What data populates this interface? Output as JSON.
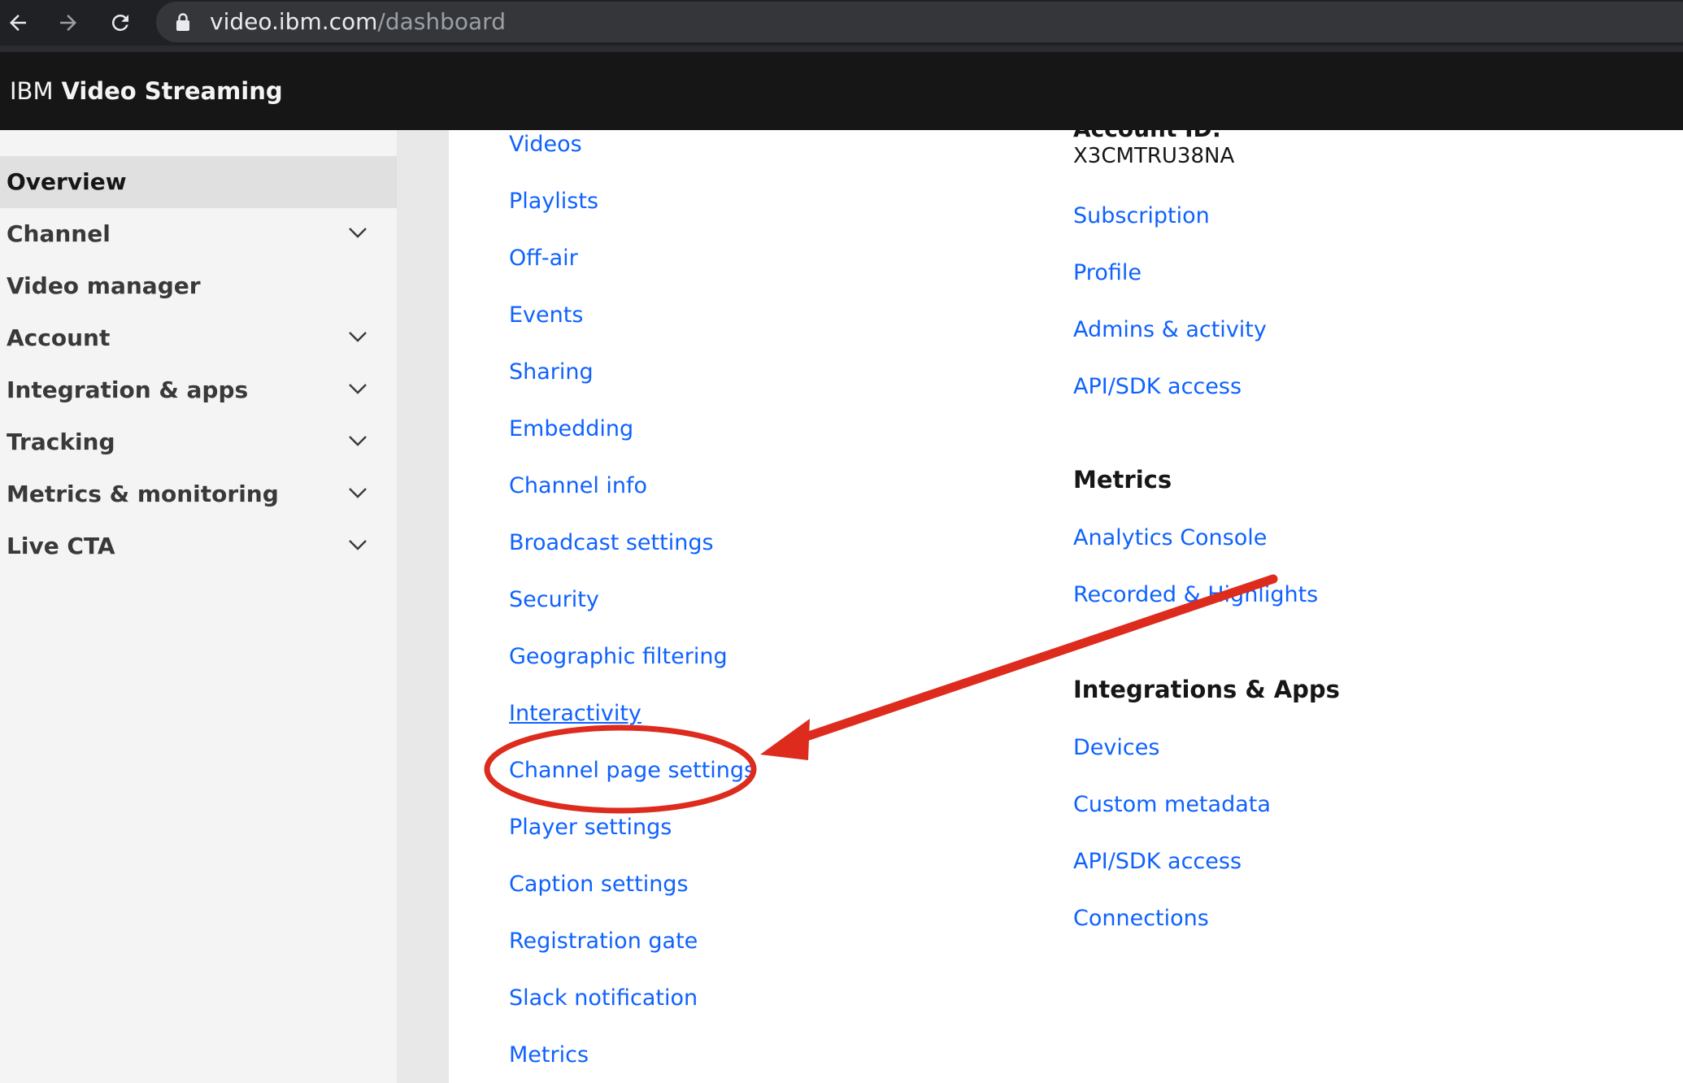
{
  "browser": {
    "url_host": "video.ibm.com",
    "url_path": "/dashboard",
    "icons": [
      "back-arrow-icon",
      "forward-arrow-icon",
      "reload-icon",
      "lock-icon"
    ]
  },
  "app": {
    "brand_prefix": "IBM",
    "brand_name": "Video Streaming"
  },
  "sidebar": {
    "items": [
      {
        "label": "Overview",
        "active": true,
        "expandable": false
      },
      {
        "label": "Channel",
        "active": false,
        "expandable": true
      },
      {
        "label": "Video manager",
        "active": false,
        "expandable": false
      },
      {
        "label": "Account",
        "active": false,
        "expandable": true
      },
      {
        "label": "Integration & apps",
        "active": false,
        "expandable": true
      },
      {
        "label": "Tracking",
        "active": false,
        "expandable": true
      },
      {
        "label": "Metrics & monitoring",
        "active": false,
        "expandable": true
      },
      {
        "label": "Live CTA",
        "active": false,
        "expandable": true
      }
    ]
  },
  "channel_links": [
    "Videos",
    "Playlists",
    "Off-air",
    "Events",
    "Sharing",
    "Embedding",
    "Channel info",
    "Broadcast settings",
    "Security",
    "Geographic filtering",
    "Interactivity",
    "Channel page settings",
    "Player settings",
    "Caption settings",
    "Registration gate",
    "Slack notification",
    "Metrics"
  ],
  "account": {
    "id_label_partial": "Account ID:",
    "id_value": "X3CMTRU38NA",
    "links": [
      "Subscription",
      "Profile",
      "Admins & activity",
      "API/SDK access"
    ]
  },
  "metrics": {
    "heading": "Metrics",
    "links": [
      "Analytics Console",
      "Recorded & Highlights"
    ]
  },
  "integrations": {
    "heading": "Integrations & Apps",
    "links": [
      "Devices",
      "Custom metadata",
      "API/SDK access",
      "Connections"
    ]
  },
  "annotation": {
    "highlighted_item": "Channel page settings",
    "color": "#dd2b1e"
  },
  "colors": {
    "link": "#0f62fe",
    "header_bg": "#161616",
    "sidebar_bg": "#f4f4f4",
    "sidebar_active": "#e0e0e0"
  }
}
